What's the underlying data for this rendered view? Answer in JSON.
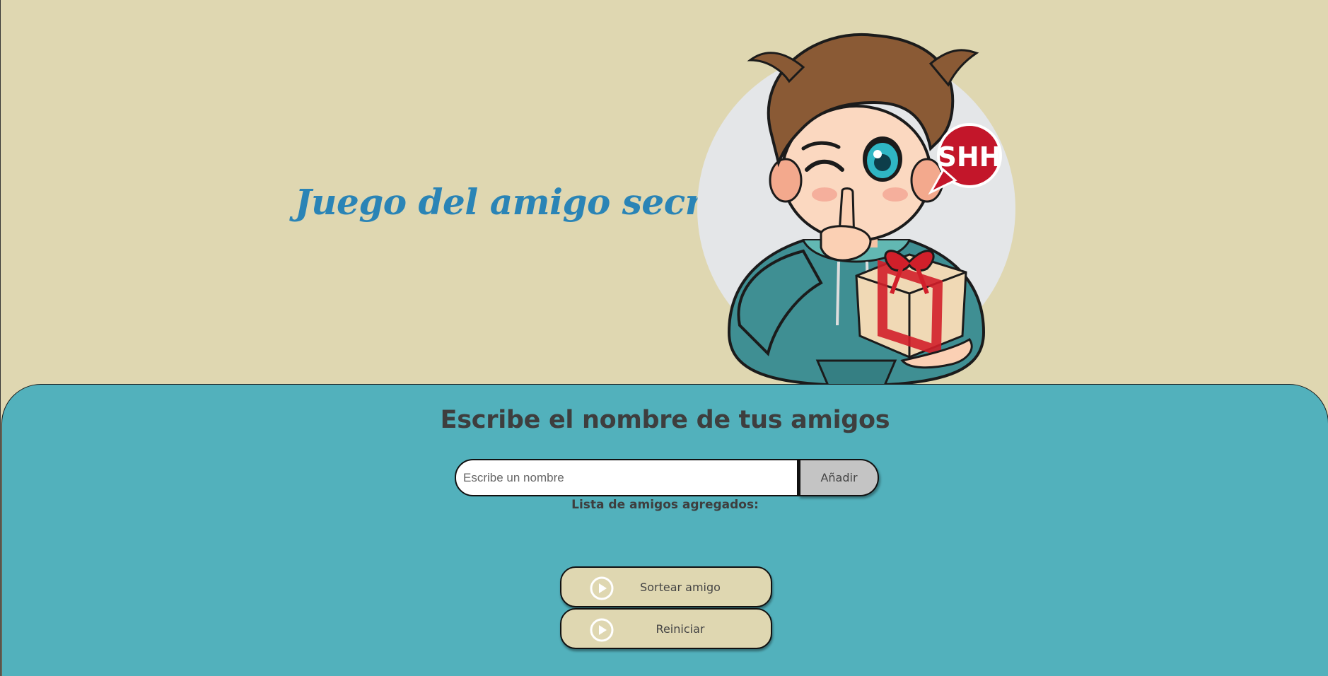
{
  "header": {
    "title": "Juego del amigo secreto",
    "mascot": {
      "icon": "secret-friend-mascot",
      "bubble_text": "SHH"
    }
  },
  "main": {
    "subtitle": "Escribe el nombre de tus amigos",
    "input": {
      "placeholder": "Escribe un nombre",
      "value": ""
    },
    "add_label": "Añadir",
    "list_label": "Lista de amigos agregados:",
    "friends": [],
    "draw_label": "Sortear amigo",
    "reset_label": "Reiniciar"
  },
  "colors": {
    "header_bg": "#dfd7b1",
    "main_bg": "#52b1bc",
    "title": "#2a84b6",
    "button_bg": "#dfd7b1",
    "add_button_bg": "#c4c4c4"
  }
}
